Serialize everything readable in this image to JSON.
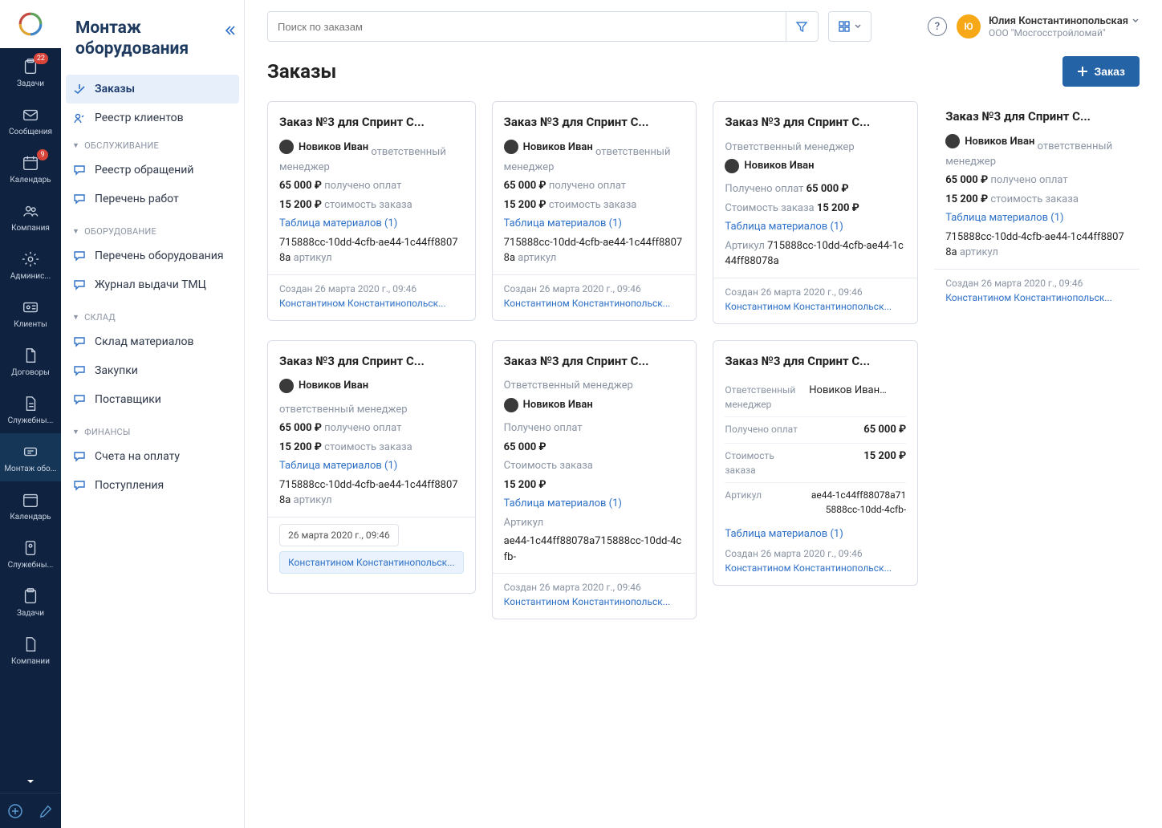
{
  "navrail": {
    "items": [
      {
        "label": "Задачи",
        "icon": "clipboard",
        "badge": "22"
      },
      {
        "label": "Сообщения",
        "icon": "mail"
      },
      {
        "label": "Календарь",
        "icon": "calendar",
        "badge": "9"
      },
      {
        "label": "Компания",
        "icon": "users"
      },
      {
        "label": "Админис...",
        "icon": "gear"
      },
      {
        "label": "Клиенты",
        "icon": "id-card"
      },
      {
        "label": "Договоры",
        "icon": "doc"
      },
      {
        "label": "Служебны...",
        "icon": "doc2"
      },
      {
        "label": "Монтаж обо...",
        "icon": "equip",
        "active": true
      },
      {
        "label": "Календарь",
        "icon": "calendar2"
      },
      {
        "label": "Служебны...",
        "icon": "person-doc"
      },
      {
        "label": "Задачи",
        "icon": "clipboard2"
      },
      {
        "label": "Компании",
        "icon": "doc3"
      }
    ]
  },
  "sidebar": {
    "title": "Монтаж оборудования",
    "top_items": [
      {
        "label": "Заказы",
        "icon": "orders",
        "active": true
      },
      {
        "label": "Реестр клиентов",
        "icon": "clients"
      }
    ],
    "sections": [
      {
        "title": "Обслуживание",
        "items": [
          {
            "label": "Реестр обращений",
            "icon": "chat"
          },
          {
            "label": "Перечень работ",
            "icon": "chat"
          }
        ]
      },
      {
        "title": "Оборудование",
        "items": [
          {
            "label": "Перечень оборудования",
            "icon": "chat"
          },
          {
            "label": "Журнал выдачи ТМЦ",
            "icon": "chat"
          }
        ]
      },
      {
        "title": "Склад",
        "items": [
          {
            "label": "Склад материалов",
            "icon": "chat"
          },
          {
            "label": "Закупки",
            "icon": "chat"
          },
          {
            "label": "Поставщики",
            "icon": "chat"
          }
        ]
      },
      {
        "title": "Финансы",
        "items": [
          {
            "label": "Счета на оплату",
            "icon": "chat"
          },
          {
            "label": "Поступления",
            "icon": "chat"
          }
        ]
      }
    ]
  },
  "topbar": {
    "search_placeholder": "Поиск по заказам",
    "user": {
      "initials": "Ю",
      "name": "Юлия Константинопольская",
      "org": "ООО \"Мосгосстройломай\""
    }
  },
  "page": {
    "title": "Заказы",
    "action_label": "Заказ"
  },
  "labels": {
    "resp_manager": "ответственный менеджер",
    "resp_manager_cap": "Ответственный менеджер",
    "received": "получено оплат",
    "received_cap": "Получено оплат",
    "cost": "стоимость заказа",
    "cost_cap": "Стоимость заказа",
    "article": "артикул",
    "article_cap": "Артикул",
    "materials": "Таблица материалов (1)",
    "created": "Создан"
  },
  "common": {
    "order_title": "Заказ №3 для Спринт С...",
    "manager": "Новиков Иван",
    "price_received": "65 000 ₽",
    "price_cost": "15 200 ₽",
    "sku": "715888cc-10dd-4cfb-ae44-1c44ff88078a",
    "sku_alt": "ae44-1c44ff88078a715888cc-10dd-4cfb-",
    "created": "26 марта 2020 г., 09:46",
    "author": "Константином Константинопольск..."
  },
  "card7_sku": "ae44-1c44ff88078a715888cc-10dd-4cfb-"
}
